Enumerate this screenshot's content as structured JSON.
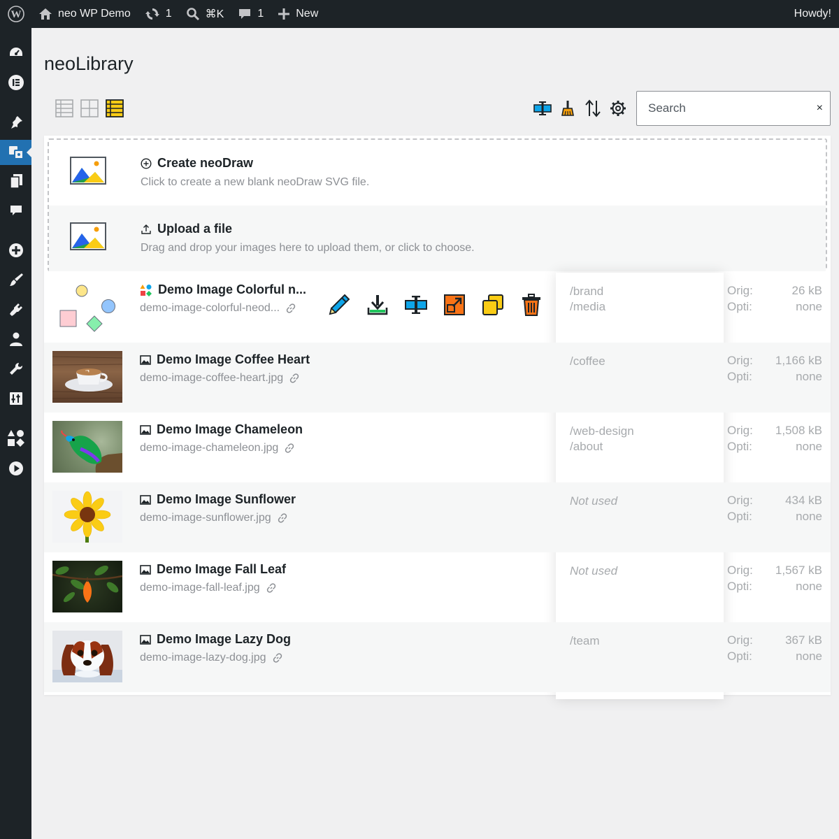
{
  "adminbar": {
    "site_name": "neo WP Demo",
    "updates_count": "1",
    "search_shortcut": "⌘K",
    "comments_count": "1",
    "new_label": "New",
    "howdy": "Howdy!"
  },
  "page": {
    "title": "neoLibrary"
  },
  "search": {
    "placeholder": "Search",
    "value": "",
    "clear": "×"
  },
  "dropzone": {
    "create_title": "Create neoDraw",
    "create_desc": "Click to create a new blank neoDraw SVG file.",
    "upload_title": "Upload a file",
    "upload_desc": "Drag and drop your images here to upload them, or click to choose."
  },
  "labels": {
    "orig": "Orig:",
    "opti": "Opti:"
  },
  "items": [
    {
      "name": "Demo Image Colorful n...",
      "file": "demo-image-colorful-neod...",
      "usage1": "/brand",
      "usage2": "/media",
      "orig": "26 kB",
      "opti": "none"
    },
    {
      "name": "Demo Image Coffee Heart",
      "file": "demo-image-coffee-heart.jpg",
      "usage1": "/coffee",
      "usage2": "",
      "orig": "1,166 kB",
      "opti": "none"
    },
    {
      "name": "Demo Image Chameleon",
      "file": "demo-image-chameleon.jpg",
      "usage1": "/web-design",
      "usage2": "/about",
      "orig": "1,508 kB",
      "opti": "none"
    },
    {
      "name": "Demo Image Sunflower",
      "file": "demo-image-sunflower.jpg",
      "usage1": "Not used",
      "usage2": "",
      "orig": "434 kB",
      "opti": "none"
    },
    {
      "name": "Demo Image Fall Leaf",
      "file": "demo-image-fall-leaf.jpg",
      "usage1": "Not used",
      "usage2": "",
      "orig": "1,567 kB",
      "opti": "none"
    },
    {
      "name": "Demo Image Lazy Dog",
      "file": "demo-image-lazy-dog.jpg",
      "usage1": "/team",
      "usage2": "",
      "orig": "367 kB",
      "opti": "none"
    }
  ],
  "colors": {
    "adminbar": "#1d2327",
    "accent": "#2271b1",
    "icon_orange": "#f97316",
    "icon_blue": "#0ea5e9",
    "icon_yellow": "#facc15"
  }
}
